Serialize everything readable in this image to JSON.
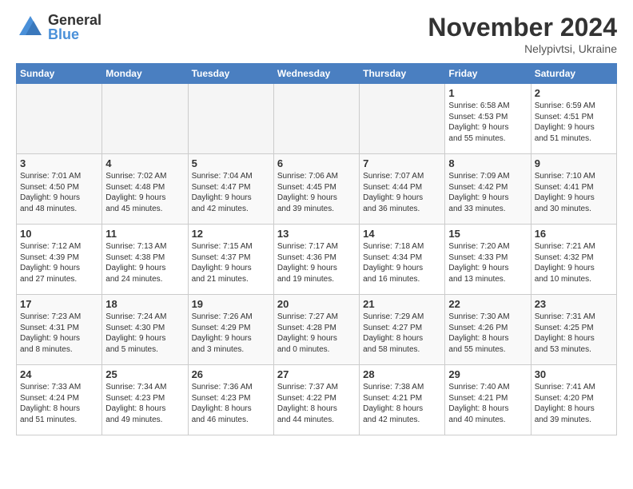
{
  "header": {
    "logo": {
      "general": "General",
      "blue": "Blue"
    },
    "title": "November 2024",
    "location": "Nelypivtsi, Ukraine"
  },
  "weekdays": [
    "Sunday",
    "Monday",
    "Tuesday",
    "Wednesday",
    "Thursday",
    "Friday",
    "Saturday"
  ],
  "weeks": [
    [
      {
        "day": "",
        "info": ""
      },
      {
        "day": "",
        "info": ""
      },
      {
        "day": "",
        "info": ""
      },
      {
        "day": "",
        "info": ""
      },
      {
        "day": "",
        "info": ""
      },
      {
        "day": "1",
        "info": "Sunrise: 6:58 AM\nSunset: 4:53 PM\nDaylight: 9 hours\nand 55 minutes."
      },
      {
        "day": "2",
        "info": "Sunrise: 6:59 AM\nSunset: 4:51 PM\nDaylight: 9 hours\nand 51 minutes."
      }
    ],
    [
      {
        "day": "3",
        "info": "Sunrise: 7:01 AM\nSunset: 4:50 PM\nDaylight: 9 hours\nand 48 minutes."
      },
      {
        "day": "4",
        "info": "Sunrise: 7:02 AM\nSunset: 4:48 PM\nDaylight: 9 hours\nand 45 minutes."
      },
      {
        "day": "5",
        "info": "Sunrise: 7:04 AM\nSunset: 4:47 PM\nDaylight: 9 hours\nand 42 minutes."
      },
      {
        "day": "6",
        "info": "Sunrise: 7:06 AM\nSunset: 4:45 PM\nDaylight: 9 hours\nand 39 minutes."
      },
      {
        "day": "7",
        "info": "Sunrise: 7:07 AM\nSunset: 4:44 PM\nDaylight: 9 hours\nand 36 minutes."
      },
      {
        "day": "8",
        "info": "Sunrise: 7:09 AM\nSunset: 4:42 PM\nDaylight: 9 hours\nand 33 minutes."
      },
      {
        "day": "9",
        "info": "Sunrise: 7:10 AM\nSunset: 4:41 PM\nDaylight: 9 hours\nand 30 minutes."
      }
    ],
    [
      {
        "day": "10",
        "info": "Sunrise: 7:12 AM\nSunset: 4:39 PM\nDaylight: 9 hours\nand 27 minutes."
      },
      {
        "day": "11",
        "info": "Sunrise: 7:13 AM\nSunset: 4:38 PM\nDaylight: 9 hours\nand 24 minutes."
      },
      {
        "day": "12",
        "info": "Sunrise: 7:15 AM\nSunset: 4:37 PM\nDaylight: 9 hours\nand 21 minutes."
      },
      {
        "day": "13",
        "info": "Sunrise: 7:17 AM\nSunset: 4:36 PM\nDaylight: 9 hours\nand 19 minutes."
      },
      {
        "day": "14",
        "info": "Sunrise: 7:18 AM\nSunset: 4:34 PM\nDaylight: 9 hours\nand 16 minutes."
      },
      {
        "day": "15",
        "info": "Sunrise: 7:20 AM\nSunset: 4:33 PM\nDaylight: 9 hours\nand 13 minutes."
      },
      {
        "day": "16",
        "info": "Sunrise: 7:21 AM\nSunset: 4:32 PM\nDaylight: 9 hours\nand 10 minutes."
      }
    ],
    [
      {
        "day": "17",
        "info": "Sunrise: 7:23 AM\nSunset: 4:31 PM\nDaylight: 9 hours\nand 8 minutes."
      },
      {
        "day": "18",
        "info": "Sunrise: 7:24 AM\nSunset: 4:30 PM\nDaylight: 9 hours\nand 5 minutes."
      },
      {
        "day": "19",
        "info": "Sunrise: 7:26 AM\nSunset: 4:29 PM\nDaylight: 9 hours\nand 3 minutes."
      },
      {
        "day": "20",
        "info": "Sunrise: 7:27 AM\nSunset: 4:28 PM\nDaylight: 9 hours\nand 0 minutes."
      },
      {
        "day": "21",
        "info": "Sunrise: 7:29 AM\nSunset: 4:27 PM\nDaylight: 8 hours\nand 58 minutes."
      },
      {
        "day": "22",
        "info": "Sunrise: 7:30 AM\nSunset: 4:26 PM\nDaylight: 8 hours\nand 55 minutes."
      },
      {
        "day": "23",
        "info": "Sunrise: 7:31 AM\nSunset: 4:25 PM\nDaylight: 8 hours\nand 53 minutes."
      }
    ],
    [
      {
        "day": "24",
        "info": "Sunrise: 7:33 AM\nSunset: 4:24 PM\nDaylight: 8 hours\nand 51 minutes."
      },
      {
        "day": "25",
        "info": "Sunrise: 7:34 AM\nSunset: 4:23 PM\nDaylight: 8 hours\nand 49 minutes."
      },
      {
        "day": "26",
        "info": "Sunrise: 7:36 AM\nSunset: 4:23 PM\nDaylight: 8 hours\nand 46 minutes."
      },
      {
        "day": "27",
        "info": "Sunrise: 7:37 AM\nSunset: 4:22 PM\nDaylight: 8 hours\nand 44 minutes."
      },
      {
        "day": "28",
        "info": "Sunrise: 7:38 AM\nSunset: 4:21 PM\nDaylight: 8 hours\nand 42 minutes."
      },
      {
        "day": "29",
        "info": "Sunrise: 7:40 AM\nSunset: 4:21 PM\nDaylight: 8 hours\nand 40 minutes."
      },
      {
        "day": "30",
        "info": "Sunrise: 7:41 AM\nSunset: 4:20 PM\nDaylight: 8 hours\nand 39 minutes."
      }
    ]
  ]
}
